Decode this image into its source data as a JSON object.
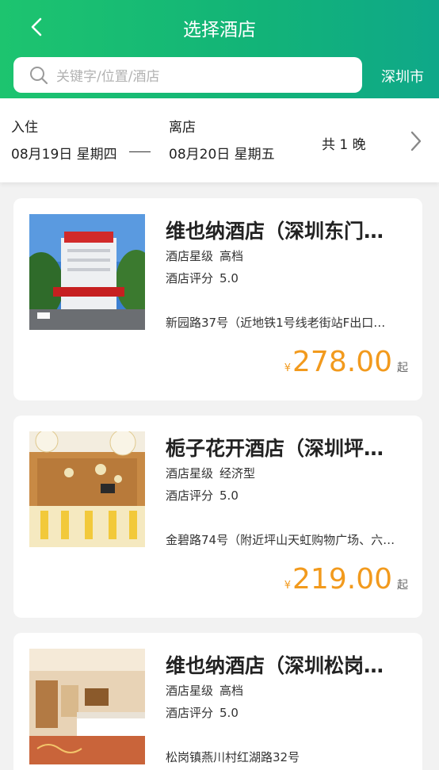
{
  "header": {
    "title": "选择酒店",
    "search_placeholder": "关键字/位置/酒店",
    "city": "深圳市"
  },
  "dates": {
    "checkin_label": "入住",
    "checkin_value": "08月19日 星期四",
    "checkout_label": "离店",
    "checkout_value": "08月20日 星期五",
    "nights": "共 1 晚"
  },
  "hotels": [
    {
      "name": "维也纳酒店（深圳东门…",
      "star_label": "酒店星级",
      "star_value": "高档",
      "rating_label": "酒店评分",
      "rating_value": "5.0",
      "address": "新园路37号（近地铁1号线老街站F出口…",
      "currency": "¥",
      "price": "278.00",
      "price_suffix": "起"
    },
    {
      "name": "栀子花开酒店（深圳坪…",
      "star_label": "酒店星级",
      "star_value": "经济型",
      "rating_label": "酒店评分",
      "rating_value": "5.0",
      "address": "金碧路74号（附近坪山天虹购物广场、六…",
      "currency": "¥",
      "price": "219.00",
      "price_suffix": "起"
    },
    {
      "name": "维也纳酒店（深圳松岗…",
      "star_label": "酒店星级",
      "star_value": "高档",
      "rating_label": "酒店评分",
      "rating_value": "5.0",
      "address": "松岗镇燕川村红湖路32号",
      "currency": "¥",
      "price": "",
      "price_suffix": ""
    }
  ],
  "colors": {
    "header_start": "#1dc46f",
    "header_end": "#0fa889",
    "price": "#f29a1d"
  },
  "icons": [
    "back-arrow-icon",
    "search-icon",
    "chevron-right-icon"
  ]
}
